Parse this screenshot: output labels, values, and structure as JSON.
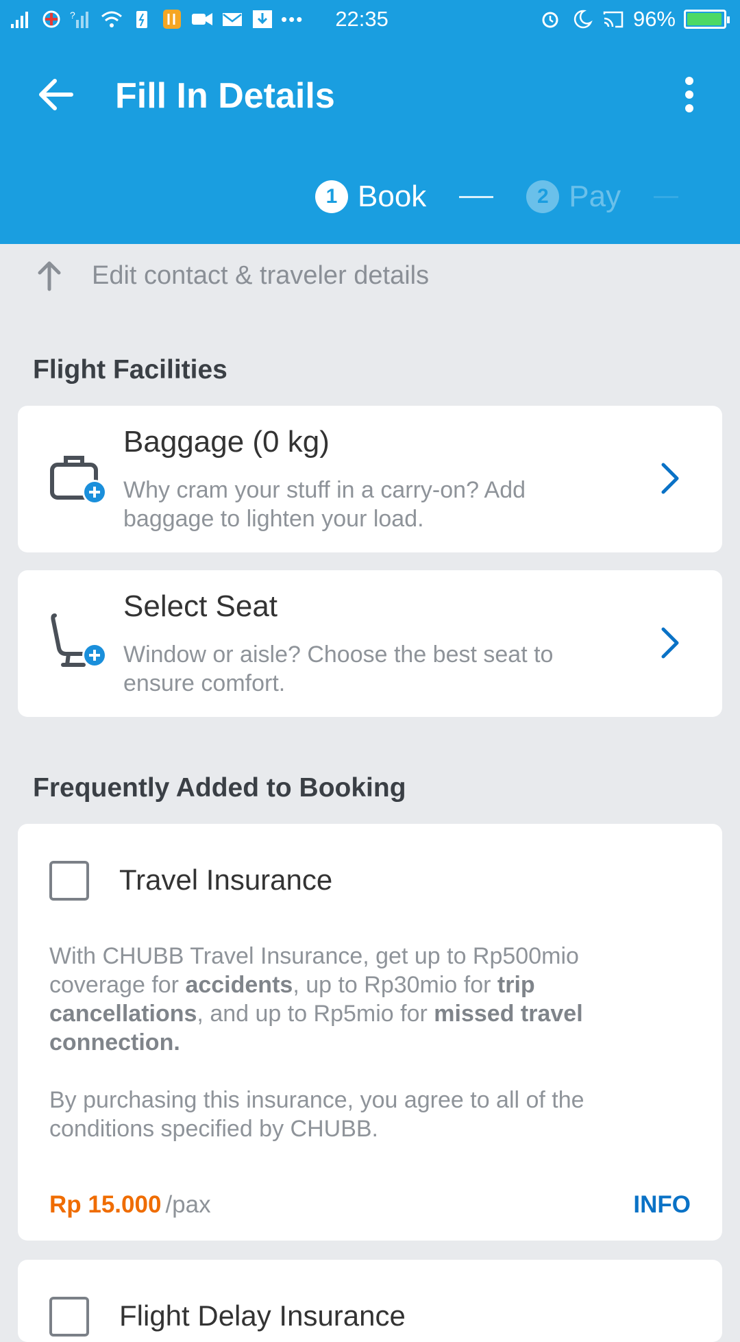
{
  "status_bar": {
    "time": "22:35",
    "battery": "96%",
    "battery_level": 0.96,
    "left_icons": [
      "signal-icon",
      "network-operator-icon",
      "signal-2-icon",
      "wifi-icon",
      "battery-saver-icon",
      "app-icon",
      "video-icon",
      "mail-icon",
      "download-icon",
      "more-icon"
    ],
    "right_icons": [
      "alarm-icon",
      "moon-icon",
      "cast-icon"
    ]
  },
  "header": {
    "title": "Fill In Details",
    "steps": [
      {
        "number": "1",
        "label": "Book",
        "active": true
      },
      {
        "number": "2",
        "label": "Pay",
        "active": false
      }
    ]
  },
  "edit_link": "Edit contact & traveler details",
  "flight_facilities": {
    "heading": "Flight Facilities",
    "items": [
      {
        "title": "Baggage (0 kg)",
        "description": "Why cram your stuff in a carry-on? Add baggage to lighten your load.",
        "icon": "baggage-add-icon"
      },
      {
        "title": "Select Seat",
        "description": "Window or aisle? Choose the best seat to ensure comfort.",
        "icon": "seat-add-icon"
      }
    ]
  },
  "frequently_added": {
    "heading": "Frequently Added to Booking",
    "travel_insurance": {
      "title": "Travel Insurance",
      "desc_1": "With CHUBB Travel Insurance, get up to Rp500mio coverage for ",
      "desc_b1": "accidents",
      "desc_2": ", up to Rp30mio for ",
      "desc_b2": "trip cancellations",
      "desc_3": ", and up to Rp5mio for ",
      "desc_b3": "missed travel connection.",
      "note": "By purchasing this insurance, you agree to all of the conditions specified by CHUBB.",
      "price": "Rp 15.000",
      "price_unit": "/pax",
      "info_label": "INFO"
    },
    "flight_delay_insurance": {
      "title": "Flight Delay Insurance"
    }
  },
  "colors": {
    "primary": "#1a9ee0",
    "price": "#ef6c00",
    "link": "#0a72c6"
  }
}
